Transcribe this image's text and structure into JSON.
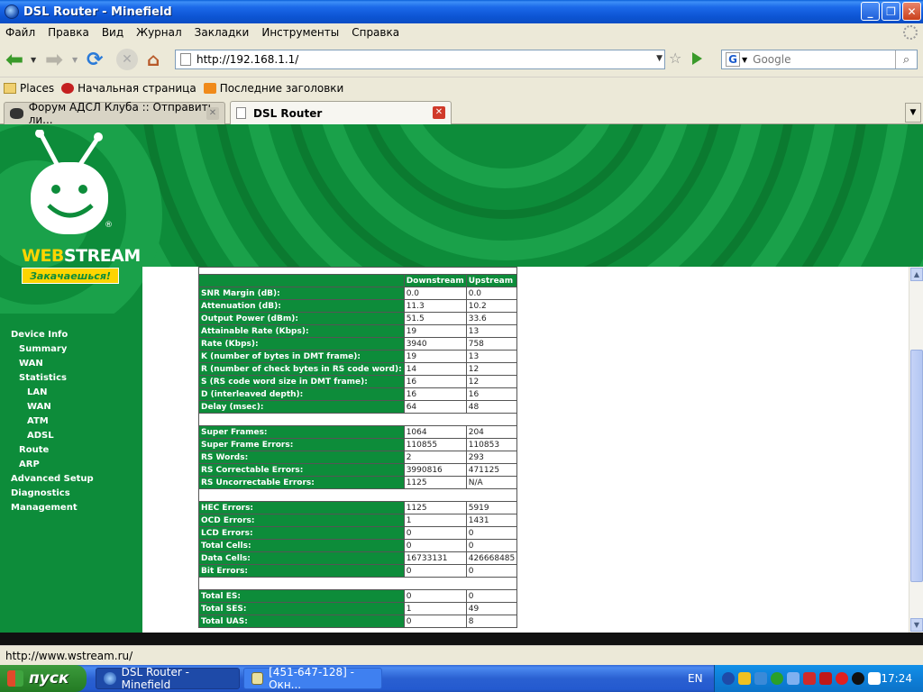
{
  "window": {
    "title": "DSL Router - Minefield"
  },
  "menu": [
    "Файл",
    "Правка",
    "Вид",
    "Журнал",
    "Закладки",
    "Инструменты",
    "Справка"
  ],
  "address": {
    "url": "http://192.168.1.1/"
  },
  "search": {
    "engine_letter": "G",
    "placeholder": "Google"
  },
  "bookmarks": [
    "Places",
    "Начальная страница",
    "Последние заголовки"
  ],
  "tabs": [
    {
      "label": "Форум АДСЛ Клуба :: Отправить ли...",
      "active": false
    },
    {
      "label": "DSL Router",
      "active": true
    }
  ],
  "brand": {
    "name_web": "WEB",
    "name_stream": "STREAM",
    "slogan": "Закачаешься!",
    "reg": "®"
  },
  "nav": [
    {
      "label": "Device Info",
      "level": 0
    },
    {
      "label": "Summary",
      "level": 1
    },
    {
      "label": "WAN",
      "level": 1
    },
    {
      "label": "Statistics",
      "level": 1
    },
    {
      "label": "LAN",
      "level": 2
    },
    {
      "label": "WAN",
      "level": 2
    },
    {
      "label": "ATM",
      "level": 2
    },
    {
      "label": "ADSL",
      "level": 2
    },
    {
      "label": "Route",
      "level": 1
    },
    {
      "label": "ARP",
      "level": 1
    },
    {
      "label": "Advanced Setup",
      "level": 0
    },
    {
      "label": "Diagnostics",
      "level": 0
    },
    {
      "label": "Management",
      "level": 0
    }
  ],
  "stats": {
    "headers": [
      "Downstream",
      "Upstream"
    ],
    "rows": [
      [
        "SNR Margin (dB):",
        "0.0",
        "0.0"
      ],
      [
        "Attenuation (dB):",
        "11.3",
        "10.2"
      ],
      [
        "Output Power (dBm):",
        "51.5",
        "33.6"
      ],
      [
        "Attainable Rate (Kbps):",
        "19",
        "13"
      ],
      [
        "Rate (Kbps):",
        "3940",
        "758"
      ],
      [
        "K (number of bytes in DMT frame):",
        "19",
        "13"
      ],
      [
        "R (number of check bytes in RS code word):",
        "14",
        "12"
      ],
      [
        "S (RS code word size in DMT frame):",
        "16",
        "12"
      ],
      [
        "D (interleaved depth):",
        "16",
        "16"
      ],
      [
        "Delay (msec):",
        "64",
        "48"
      ],
      null,
      [
        "Super Frames:",
        "1064",
        "204"
      ],
      [
        "Super Frame Errors:",
        "110855",
        "110853"
      ],
      [
        "RS Words:",
        "2",
        "293"
      ],
      [
        "RS Correctable Errors:",
        "3990816",
        "471125"
      ],
      [
        "RS Uncorrectable Errors:",
        "1125",
        "N/A"
      ],
      null,
      [
        "HEC Errors:",
        "1125",
        "5919"
      ],
      [
        "OCD Errors:",
        "1",
        "1431"
      ],
      [
        "LCD Errors:",
        "0",
        "0"
      ],
      [
        "Total Cells:",
        "0",
        "0"
      ],
      [
        "Data Cells:",
        "16733131",
        "426668485"
      ],
      [
        "Bit Errors:",
        "0",
        "0"
      ],
      null,
      [
        "Total ES:",
        "0",
        "0"
      ],
      [
        "Total SES:",
        "1",
        "49"
      ],
      [
        "Total UAS:",
        "0",
        "8"
      ]
    ]
  },
  "status_bar": {
    "text": "http://www.wstream.ru/"
  },
  "taskbar": {
    "start_label": "пуск",
    "tasks": [
      {
        "label": "DSL Router - Minefield",
        "active": true
      },
      {
        "label": "[451-647-128] - Окн...",
        "active": false
      }
    ],
    "lang": "EN",
    "clock": "17:24"
  },
  "colors": {
    "brand_green": "#0d8c3a",
    "brand_yellow": "#fdd400",
    "xp_blue": "#245ad0"
  }
}
